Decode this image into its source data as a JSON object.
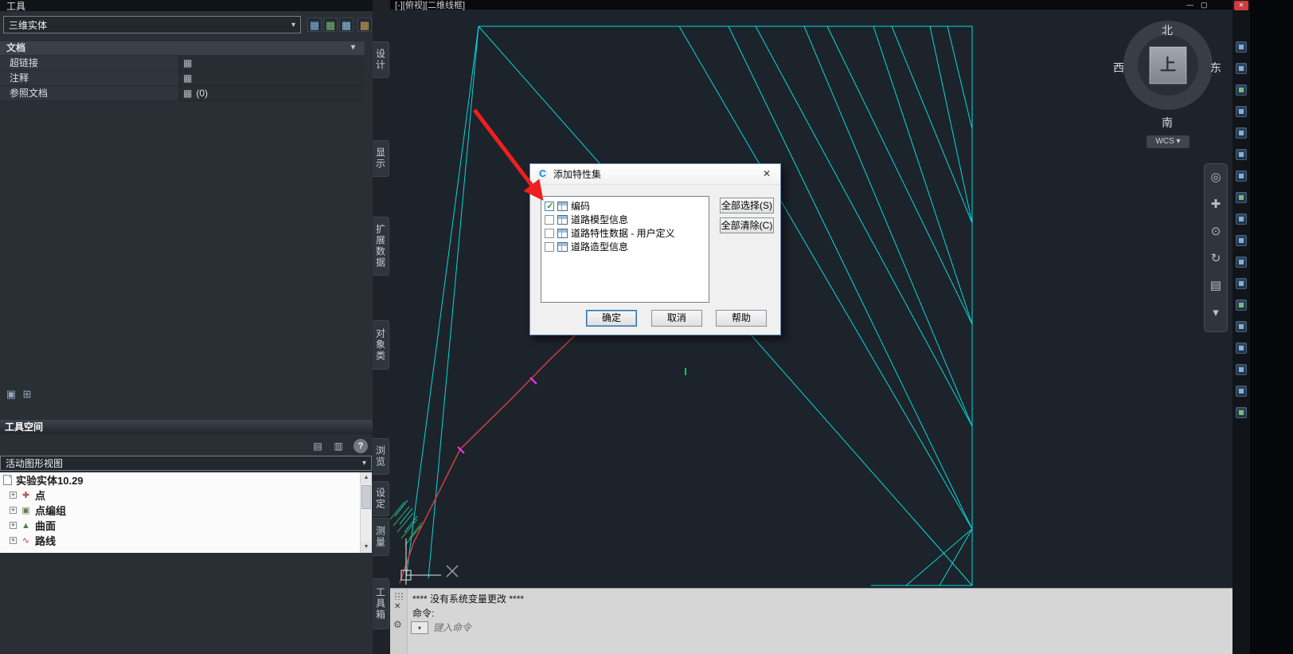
{
  "window": {
    "title_fragment": "工具",
    "viewport_label": "[-][俯视][二维线框]",
    "minimize": "—",
    "maximize": "▢",
    "close": "✕"
  },
  "icons": {
    "close": "✕",
    "chevron_down": "▾",
    "grid": "▦",
    "plus": "+",
    "up": "▲",
    "down": "▼",
    "help": "?",
    "panel": "▣",
    "pin": "⊞",
    "layout_a": "▤",
    "layout_b": "▥",
    "prompt_arrow": "▾",
    "wrench": "⚙"
  },
  "properties_palette": {
    "selector_value": "三维实体",
    "section_title": "文档",
    "rows": [
      {
        "label": "超链接",
        "value": ""
      },
      {
        "label": "注释",
        "value": ""
      },
      {
        "label": "参照文档",
        "value": "(0)"
      }
    ],
    "tabs": [
      "设计",
      "显示",
      "扩展数据",
      "对象类"
    ]
  },
  "toolspace": {
    "title": "工具空间",
    "view_selector": "活动图形视图",
    "tree": [
      {
        "label": "实验实体10.29",
        "icon": "drawing"
      },
      {
        "label": "点",
        "icon": "✚"
      },
      {
        "label": "点编组",
        "icon": "▣"
      },
      {
        "label": "曲面",
        "icon": "▲"
      },
      {
        "label": "路线",
        "icon": "∿"
      }
    ],
    "tabs": [
      "浏览",
      "设定",
      "测量",
      "工具箱"
    ]
  },
  "dialog": {
    "title": "添加特性集",
    "close": "✕",
    "items": [
      {
        "label": "编码",
        "checked": true
      },
      {
        "label": "道路模型信息",
        "checked": false
      },
      {
        "label": "道路特性数据 - 用户定义",
        "checked": false
      },
      {
        "label": "道路造型信息",
        "checked": false
      }
    ],
    "buttons": {
      "select_all": "全部选择(S)",
      "clear_all": "全部清除(C)",
      "ok": "确定",
      "cancel": "取消",
      "help": "帮助"
    }
  },
  "viewcube": {
    "north": "北",
    "south": "南",
    "east": "东",
    "west": "西",
    "top_face": "上",
    "wcs": "WCS"
  },
  "navbar": {
    "icons": [
      {
        "name": "navigation-wheel-icon",
        "glyph": "◎"
      },
      {
        "name": "pan-icon",
        "glyph": "✚"
      },
      {
        "name": "zoom-icon",
        "glyph": "⊙"
      },
      {
        "name": "orbit-icon",
        "glyph": "↻"
      },
      {
        "name": "showmotion-icon",
        "glyph": "▤"
      },
      {
        "name": "navbar-more-icon",
        "glyph": "▾"
      }
    ]
  },
  "command": {
    "history_line": "****  没有系统变量更改  ****",
    "command_line": "命令:",
    "prompt": "键入命令"
  },
  "colors": {
    "canvas_bg": "#1d232b",
    "line_cyan": "#00dada",
    "line_red": "#d04040",
    "marker_magenta": "#ff2fff",
    "marker_green": "#00d24a",
    "annotation_arrow": "#f01f1f"
  }
}
